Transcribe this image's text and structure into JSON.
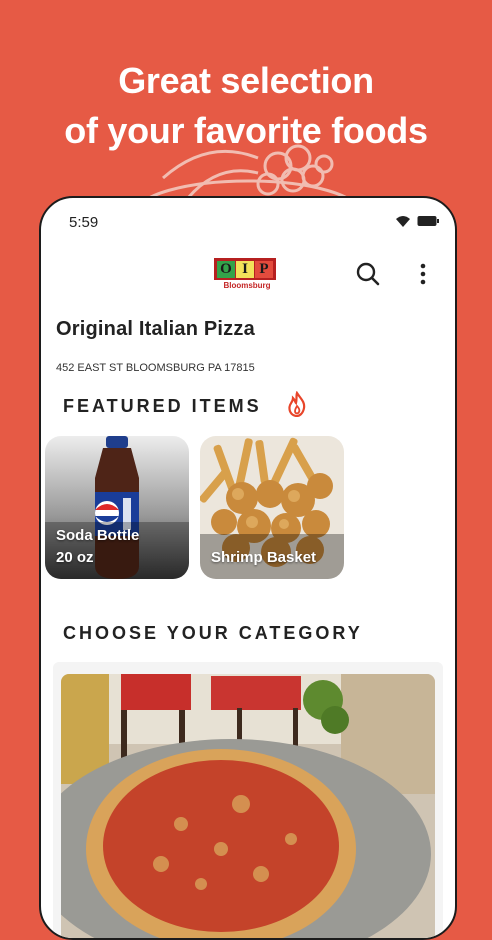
{
  "promo": {
    "line1": "Great selection",
    "line2": "of your favorite foods"
  },
  "status_bar": {
    "time": "5:59"
  },
  "header": {
    "logo": {
      "letters": [
        "O",
        "I",
        "P"
      ],
      "subtitle": "Bloomsburg"
    },
    "search_icon": "search-icon",
    "menu_icon": "more-vertical-icon"
  },
  "restaurant": {
    "name": "Original Italian Pizza",
    "address": "452 EAST ST BLOOMSBURG PA 17815"
  },
  "featured": {
    "title": "FEATURED ITEMS",
    "icon": "fire-icon",
    "items": [
      {
        "line1": "Soda Bottle",
        "line2": "20 oz"
      },
      {
        "line1": "Shrimp Basket"
      }
    ]
  },
  "categories": {
    "title": "CHOOSE YOUR CATEGORY"
  },
  "colors": {
    "background": "#e65a45",
    "accent": "#e8452a"
  }
}
